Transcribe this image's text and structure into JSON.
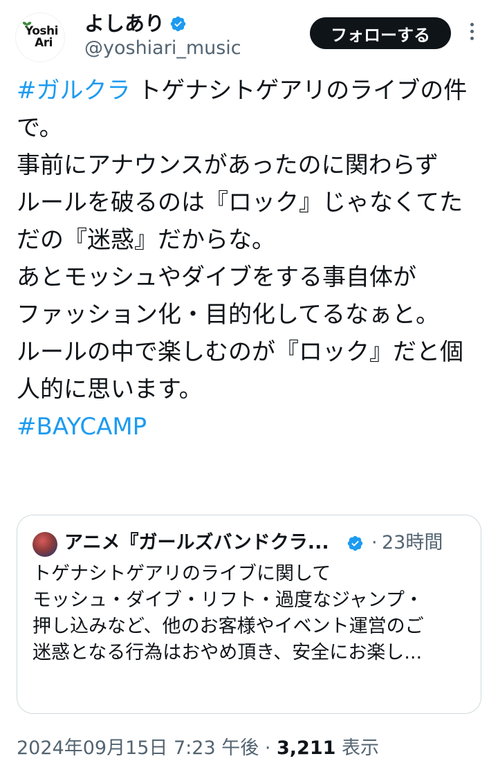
{
  "author": {
    "avatar_text_line1": "Yoshi",
    "avatar_text_line2": "Ari",
    "display_name": "よしあり",
    "handle": "@yoshiari_music",
    "verified": true
  },
  "follow_label": "フォローする",
  "tweet": {
    "lines": [
      {
        "hashtag": "#ガルクラ",
        "text": " トゲナシトゲアリのライブの件"
      },
      {
        "hashtag": "",
        "text": "で。"
      },
      {
        "hashtag": "",
        "text": ""
      },
      {
        "hashtag": "",
        "text": "事前にアナウンスがあったのに関わらず"
      },
      {
        "hashtag": "",
        "text": "ルールを破るのは『ロック』じゃなくてた"
      },
      {
        "hashtag": "",
        "text": "だの『迷惑』だからな。"
      },
      {
        "hashtag": "",
        "text": ""
      },
      {
        "hashtag": "",
        "text": "あとモッシュやダイブをする事自体が"
      },
      {
        "hashtag": "",
        "text": "ファッション化・目的化してるなぁと。"
      },
      {
        "hashtag": "",
        "text": ""
      },
      {
        "hashtag": "",
        "text": "ルールの中で楽しむのが『ロック』だと個"
      },
      {
        "hashtag": "",
        "text": "人的に思います。"
      },
      {
        "hashtag": "#BAYCAMP",
        "text": ""
      }
    ]
  },
  "quote": {
    "display_name": "アニメ『ガールズバンドクラ...",
    "verified": true,
    "separator": "·",
    "time": "23時間",
    "lines": [
      "トゲナシトゲアリのライブに関して",
      "",
      "モッシュ・ダイブ・リフト・過度なジャンプ・",
      "押し込みなど、他のお客様やイベント運営のご",
      "迷惑となる行為はおやめ頂き、安全にお楽し..."
    ]
  },
  "meta": {
    "timestamp": "2024年09月15日 7:23 午後",
    "separator": " · ",
    "views_count": "3,211",
    "views_label": " 表示"
  },
  "colors": {
    "link": "#1d9bf0",
    "text": "#0f1419",
    "secondary": "#536471",
    "verified": "#1d9bf0"
  }
}
